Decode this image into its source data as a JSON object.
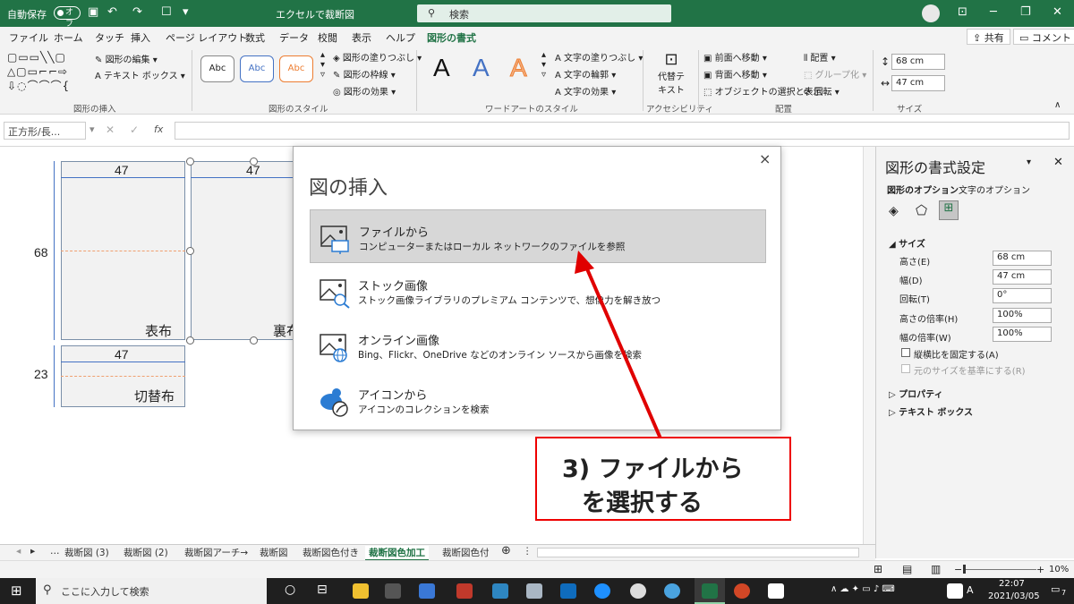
{
  "titlebar": {
    "autosave_label": "自動保存",
    "autosave_state": "オフ",
    "filename": "エクセルで裁断図",
    "search_placeholder": "検索"
  },
  "menu": {
    "items": [
      "ファイル",
      "ホーム",
      "タッチ",
      "挿入",
      "ページ レイアウト",
      "数式",
      "データ",
      "校閲",
      "表示",
      "ヘルプ"
    ],
    "active": "図形の書式",
    "share": "共有",
    "comment": "コメント"
  },
  "ribbon": {
    "edit_shape": "図形の編集",
    "text_box": "テキスト ボックス",
    "group_insert": "図形の挿入",
    "style_sample": "Abc",
    "fill": "図形の塗りつぶし",
    "outline": "図形の枠線",
    "effect": "図形の効果",
    "group_style": "図形のスタイル",
    "wordart_letter": "A",
    "text_fill": "文字の塗りつぶし",
    "text_outline": "文字の輪郭",
    "text_effect": "文字の効果",
    "group_wordart": "ワードアートのスタイル",
    "alt_text_1": "代替テ",
    "alt_text_2": "キスト",
    "group_access": "アクセシビリティ",
    "bring_forward": "前面へ移動",
    "send_backward": "背面へ移動",
    "selection_pane": "オブジェクトの選択と表示",
    "align": "配置",
    "group": "グループ化",
    "rotate": "回転",
    "group_arrange": "配置",
    "height": "68 cm",
    "width": "47 cm",
    "group_size": "サイズ"
  },
  "formula": {
    "name_box": "正方形/長...",
    "fx": "fx"
  },
  "sheet": {
    "shape1": {
      "width_dim": "47",
      "height_dim": "68",
      "label": "表布"
    },
    "shape2": {
      "width_dim": "47",
      "label": "裏布"
    },
    "shape3": {
      "width_dim": "47",
      "height_dim": "23",
      "label": "切替布"
    }
  },
  "dialog": {
    "title": "図の挿入",
    "close": "×",
    "options": [
      {
        "title": "ファイルから",
        "desc": "コンピューターまたはローカル ネットワークのファイルを参照"
      },
      {
        "title": "ストック画像",
        "desc": "ストック画像ライブラリのプレミアム コンテンツで、想像力を解き放つ"
      },
      {
        "title": "オンライン画像",
        "desc": "Bing、Flickr、OneDrive などのオンライン ソースから画像を検索"
      },
      {
        "title": "アイコンから",
        "desc": "アイコンのコレクションを検索"
      }
    ]
  },
  "callout": {
    "line1": "3) ファイルから",
    "line2": "を選択する",
    "color": "#e00000"
  },
  "pane": {
    "title": "図形の書式設定",
    "tab_shape": "図形のオプション",
    "tab_text": "文字のオプション",
    "section_size": "サイズ",
    "height_label": "高さ(E)",
    "height_value": "68 cm",
    "width_label": "幅(D)",
    "width_value": "47 cm",
    "rotation_label": "回転(T)",
    "rotation_value": "0°",
    "scale_h_label": "高さの倍率(H)",
    "scale_h_value": "100%",
    "scale_w_label": "幅の倍率(W)",
    "scale_w_value": "100%",
    "lock_aspect": "縦横比を固定する(A)",
    "relative_original": "元のサイズを基準にする(R)",
    "section_properties": "プロパティ",
    "section_textbox": "テキスト ボックス"
  },
  "sheet_tabs": {
    "tabs": [
      "裁断図 (3)",
      "裁断図 (2)",
      "裁断図アーチ→",
      "裁断図",
      "裁断図色付き",
      "裁断図色加工",
      "裁断図色付"
    ],
    "active_index": 5
  },
  "status": {
    "zoom": "10%"
  },
  "taskbar": {
    "search_placeholder": "ここに入力して検索",
    "time": "22:07",
    "date": "2021/03/05",
    "notification_count": "7"
  },
  "colors": {
    "excel_green": "#217346",
    "callout_red": "#e00000"
  }
}
